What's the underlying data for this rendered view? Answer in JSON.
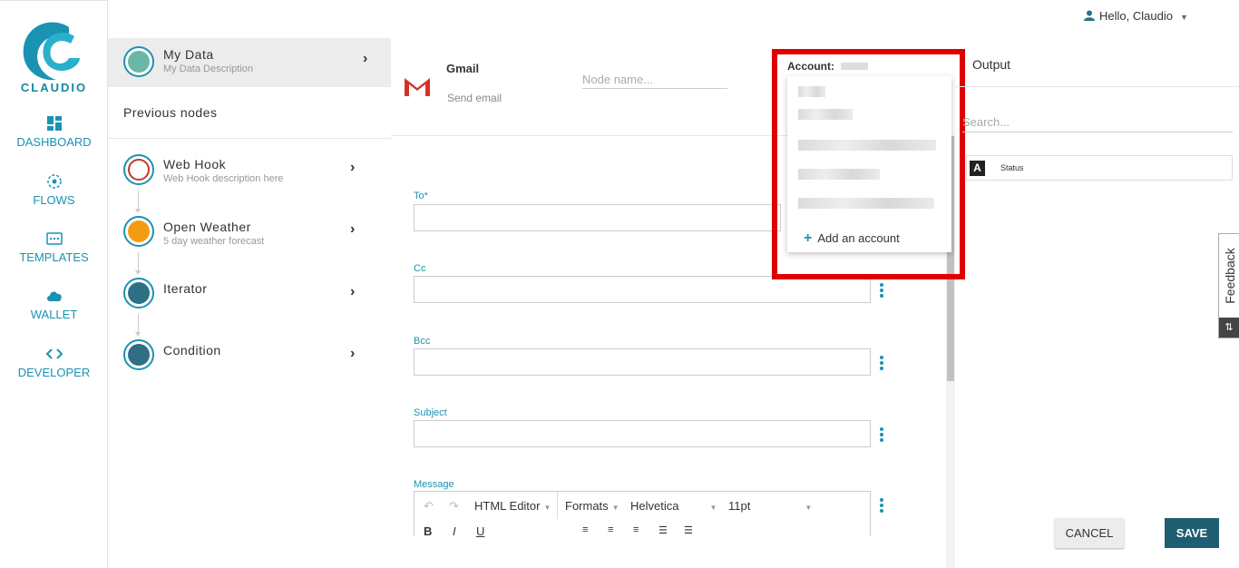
{
  "header": {
    "greeting": "Hello, Claudio"
  },
  "brand": {
    "name": "CLAUDIO",
    "accent": "#1a93b3"
  },
  "nav": [
    {
      "label": "DASHBOARD",
      "icon": "dashboard-icon"
    },
    {
      "label": "FLOWS",
      "icon": "flows-icon"
    },
    {
      "label": "TEMPLATES",
      "icon": "templates-icon"
    },
    {
      "label": "WALLET",
      "icon": "cloud-icon"
    },
    {
      "label": "DEVELOPER",
      "icon": "code-icon"
    }
  ],
  "mydata": {
    "title": "My Data",
    "description": "My Data Description"
  },
  "previous_nodes": {
    "title": "Previous nodes",
    "items": [
      {
        "title": "Web Hook",
        "description": "Web Hook description here",
        "icon": "webhook-icon"
      },
      {
        "title": "Open Weather",
        "description": "5 day weather forecast",
        "icon": "weather-icon"
      },
      {
        "title": "Iterator",
        "description": "",
        "icon": "iterator-icon"
      },
      {
        "title": "Condition",
        "description": "",
        "icon": "condition-icon"
      }
    ]
  },
  "node": {
    "title": "Gmail",
    "subtitle": "Send email",
    "name_placeholder": "Node name..."
  },
  "form": {
    "to_label": "To",
    "to_required": "*",
    "cc_label": "Cc",
    "bcc_label": "Bcc",
    "subject_label": "Subject",
    "message_label": "Message",
    "editor": {
      "html_editor": "HTML Editor",
      "formats": "Formats",
      "font": "Helvetica",
      "size": "11pt"
    }
  },
  "account": {
    "label": "Account:",
    "add_label": "Add an account",
    "highlight_color": "#e10000"
  },
  "output": {
    "title": "Output",
    "search_placeholder": "Search...",
    "fields": [
      {
        "type": "A",
        "label": "Status"
      }
    ]
  },
  "feedback": {
    "label": "Feedback"
  },
  "actions": {
    "cancel": "CANCEL",
    "save": "SAVE"
  }
}
